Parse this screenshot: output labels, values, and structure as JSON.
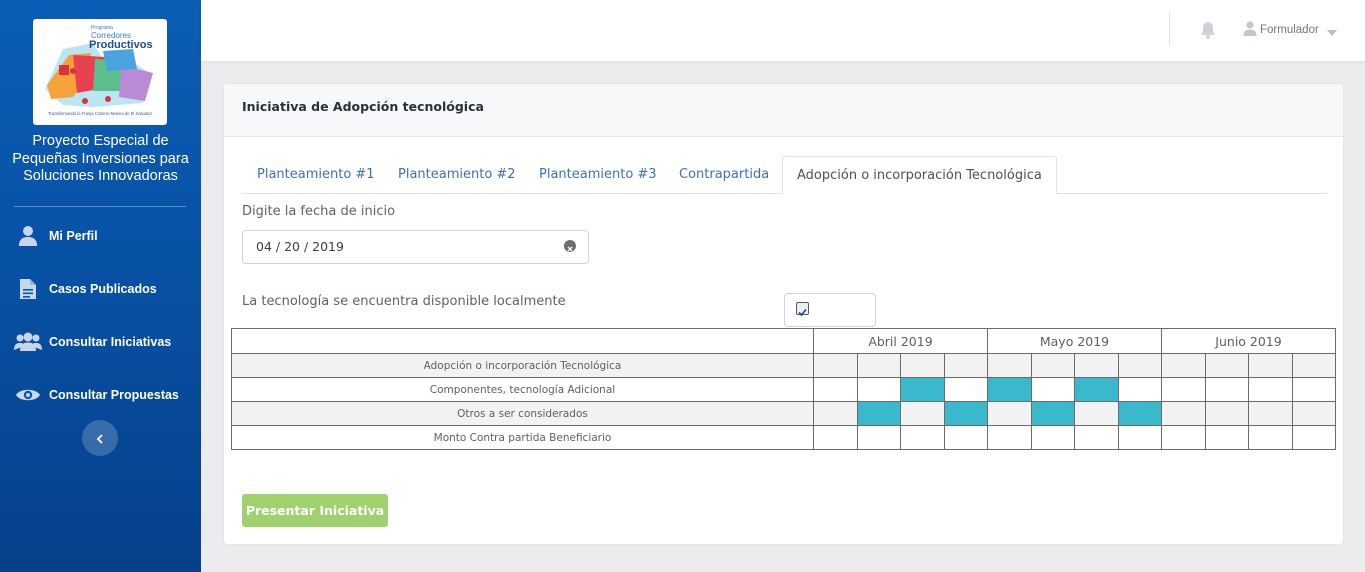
{
  "sidebar": {
    "logo": {
      "program": "Programa",
      "name_line1": "Corredores",
      "name_line2": "Productivos",
      "tagline": "Transformando la Franja Costero-Marina de El Salvador"
    },
    "project_title": "Proyecto Especial de Pequeñas Inversiones para Soluciones Innovadoras",
    "items": [
      {
        "label": "Mi Perfil",
        "icon": "user-icon"
      },
      {
        "label": "Casos Publicados",
        "icon": "document-icon"
      },
      {
        "label": "Consultar Iniciativas",
        "icon": "users-icon"
      },
      {
        "label": "Consultar Propuestas",
        "icon": "eye-icon"
      }
    ],
    "collapse_icon": "chevron-left-icon"
  },
  "topbar": {
    "notification_icon": "bell-icon",
    "user_name": "Formulador",
    "user_icon": "user-icon",
    "caret_icon": "caret-down-icon"
  },
  "card": {
    "title": "Iniciativa de Adopción tecnológica",
    "tabs": [
      {
        "label": "Planteamiento #1",
        "active": false
      },
      {
        "label": "Planteamiento #2",
        "active": false
      },
      {
        "label": "Planteamiento #3",
        "active": false
      },
      {
        "label": "Contrapartida",
        "active": false
      },
      {
        "label": "Adopción o incorporación Tecnológica",
        "active": true
      }
    ],
    "date_label": "Digite la fecha de inicio",
    "date_value": "04 / 20 / 2019",
    "availability_label": "La tecnología se encuentra disponible localmente",
    "availability_checked": true,
    "submit_label": "Presentar Iniciativa"
  },
  "gantt": {
    "months": [
      "Abril 2019",
      "Mayo 2019",
      "Junio 2019"
    ],
    "weeks_per_month": 4,
    "rows": [
      {
        "label": "Adopción o incorporación Tecnológica",
        "filled": []
      },
      {
        "label": "Componentes, tecnología Adicional",
        "filled": [
          2,
          4,
          6
        ]
      },
      {
        "label": "Otros a ser considerados",
        "filled": [
          1,
          3,
          5,
          7
        ]
      },
      {
        "label": "Monto Contra partida Beneficiario",
        "filled": []
      }
    ],
    "fill_color": "#3bb9cc"
  },
  "colors": {
    "sidebar": "#0852a6",
    "accent_link": "#3d6fbe",
    "submit_button": "#9fd26f"
  }
}
